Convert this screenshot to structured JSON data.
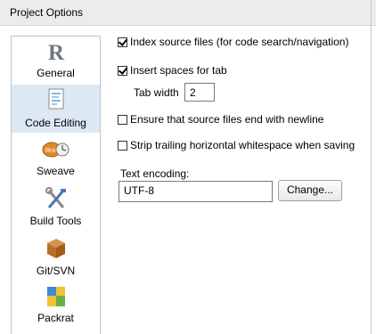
{
  "window": {
    "title": "Project Options"
  },
  "sidebar": {
    "items": [
      {
        "label": "General",
        "icon": "r-logo-icon",
        "selected": false
      },
      {
        "label": "Code Editing",
        "icon": "code-editing-icon",
        "selected": true
      },
      {
        "label": "Sweave",
        "icon": "sweave-icon",
        "selected": false
      },
      {
        "label": "Build Tools",
        "icon": "build-tools-icon",
        "selected": false
      },
      {
        "label": "Git/SVN",
        "icon": "git-svn-icon",
        "selected": false
      },
      {
        "label": "Packrat",
        "icon": "packrat-icon",
        "selected": false
      }
    ]
  },
  "options": {
    "index_source": {
      "label": "Index source files (for code search/navigation)",
      "checked": true
    },
    "insert_spaces": {
      "label": "Insert spaces for tab",
      "checked": true
    },
    "tab_width": {
      "label": "Tab width",
      "value": "2"
    },
    "ensure_newline": {
      "label": "Ensure that source files end with newline",
      "checked": false
    },
    "strip_whitespace": {
      "label": "Strip trailing horizontal whitespace when saving",
      "checked": false
    },
    "encoding": {
      "label": "Text encoding:",
      "value": "UTF-8",
      "button": "Change..."
    }
  },
  "colors": {
    "selected_bg": "#dde8f5",
    "accent_blue": "#2a6fd1"
  }
}
